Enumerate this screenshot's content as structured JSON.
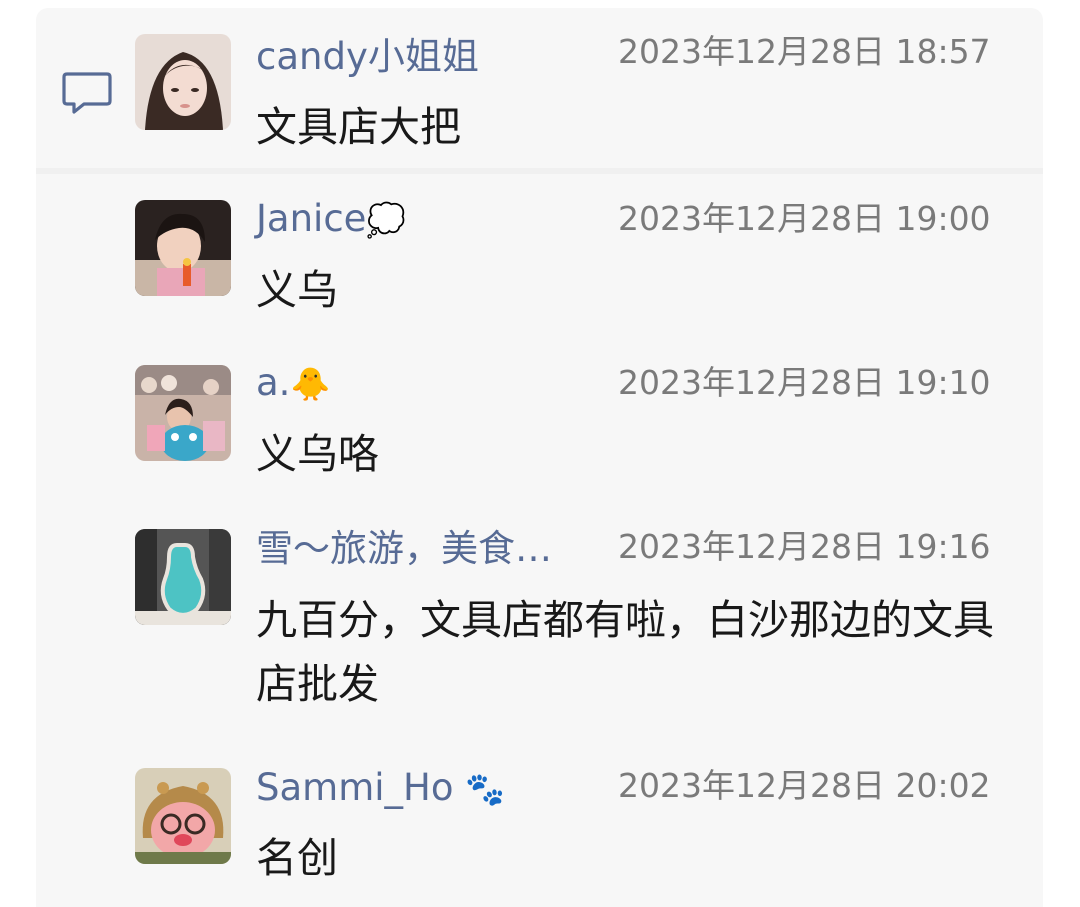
{
  "comments": [
    {
      "name": "candy小姐姐",
      "emoji": "",
      "time": "2023年12月28日 18:57",
      "text": "文具店大把"
    },
    {
      "name": "Janice",
      "emoji": "💭",
      "time": "2023年12月28日 19:00",
      "text": "义乌"
    },
    {
      "name": "a.",
      "emoji": "🐥",
      "time": "2023年12月28日 19:10",
      "text": "义乌咯"
    },
    {
      "name": "雪～旅游，美食…",
      "emoji": "",
      "time": "2023年12月28日 19:16",
      "text": "九百分，文具店都有啦，白沙那边的文具店批发"
    },
    {
      "name": "Sammi_Ho",
      "emoji": "🐾",
      "time": "2023年12月28日 20:02",
      "text": "名创"
    }
  ],
  "icons": {
    "comment_icon": "comment-bubble-icon"
  },
  "colors": {
    "name": "#576b95",
    "time": "#7a7a7a",
    "text": "#191919",
    "panel": "#f7f7f7"
  }
}
